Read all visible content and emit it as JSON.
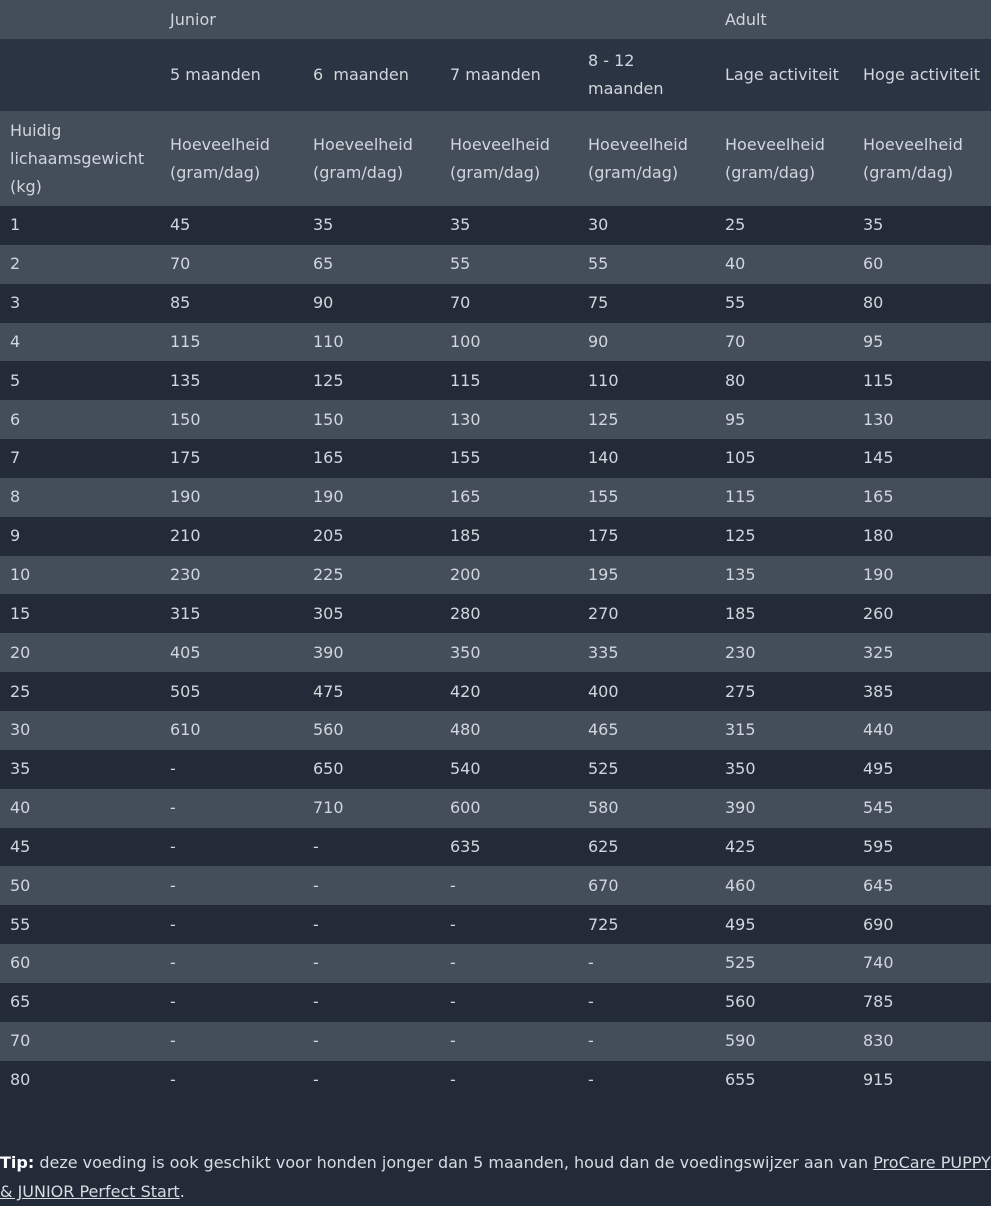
{
  "header": {
    "groups": {
      "junior": "Junior",
      "adult": "Adult"
    },
    "ages": [
      "5 maanden",
      "6  maanden",
      "7 maanden",
      "8 - 12 maanden",
      "Lage activiteit",
      "Hoge activiteit"
    ],
    "weight_label": "Huidig lichaamsgewicht (kg)",
    "quantity_label": "Hoeveelheid (gram/dag)"
  },
  "rows": [
    {
      "kg": "1",
      "values": [
        "45",
        "35",
        "35",
        "30",
        "25",
        "35"
      ]
    },
    {
      "kg": "2",
      "values": [
        "70",
        "65",
        "55",
        "55",
        "40",
        "60"
      ]
    },
    {
      "kg": "3",
      "values": [
        "85",
        "90",
        "70",
        "75",
        "55",
        "80"
      ]
    },
    {
      "kg": "4",
      "values": [
        "115",
        "110",
        "100",
        "90",
        "70",
        "95"
      ]
    },
    {
      "kg": "5",
      "values": [
        "135",
        "125",
        "115",
        "110",
        "80",
        "115"
      ]
    },
    {
      "kg": "6",
      "values": [
        "150",
        "150",
        "130",
        "125",
        "95",
        "130"
      ]
    },
    {
      "kg": "7",
      "values": [
        "175",
        "165",
        "155",
        "140",
        "105",
        "145"
      ]
    },
    {
      "kg": "8",
      "values": [
        "190",
        "190",
        "165",
        "155",
        "115",
        "165"
      ]
    },
    {
      "kg": "9",
      "values": [
        "210",
        "205",
        "185",
        "175",
        "125",
        "180"
      ]
    },
    {
      "kg": "10",
      "values": [
        "230",
        "225",
        "200",
        "195",
        "135",
        "190"
      ]
    },
    {
      "kg": "15",
      "values": [
        "315",
        "305",
        "280",
        "270",
        "185",
        "260"
      ]
    },
    {
      "kg": "20",
      "values": [
        "405",
        "390",
        "350",
        "335",
        "230",
        "325"
      ]
    },
    {
      "kg": "25",
      "values": [
        "505",
        "475",
        "420",
        "400",
        "275",
        "385"
      ]
    },
    {
      "kg": "30",
      "values": [
        "610",
        "560",
        "480",
        "465",
        "315",
        "440"
      ]
    },
    {
      "kg": "35",
      "values": [
        "-",
        "650",
        "540",
        "525",
        "350",
        "495"
      ]
    },
    {
      "kg": "40",
      "values": [
        "-",
        "710",
        "600",
        "580",
        "390",
        "545"
      ]
    },
    {
      "kg": "45",
      "values": [
        "-",
        "-",
        "635",
        "625",
        "425",
        "595"
      ]
    },
    {
      "kg": "50",
      "values": [
        "-",
        "-",
        "-",
        "670",
        "460",
        "645"
      ]
    },
    {
      "kg": "55",
      "values": [
        "-",
        "-",
        "-",
        "725",
        "495",
        "690"
      ]
    },
    {
      "kg": "60",
      "values": [
        "-",
        "-",
        "-",
        "-",
        "525",
        "740"
      ]
    },
    {
      "kg": "65",
      "values": [
        "-",
        "-",
        "-",
        "-",
        "560",
        "785"
      ]
    },
    {
      "kg": "70",
      "values": [
        "-",
        "-",
        "-",
        "-",
        "590",
        "830"
      ]
    },
    {
      "kg": "80",
      "values": [
        "-",
        "-",
        "-",
        "-",
        "655",
        "915"
      ]
    }
  ],
  "tip": {
    "label": "Tip:",
    "text": " deze voeding is ook geschikt voor honden jonger dan 5 maanden, houd dan de voedingswijzer aan van ",
    "link": "ProCare PUPPY & JUNIOR Perfect Start",
    "end": "."
  },
  "colors": {
    "background": "#232b38",
    "row_alt": "#444d5a",
    "text": "#d2d6dc"
  }
}
